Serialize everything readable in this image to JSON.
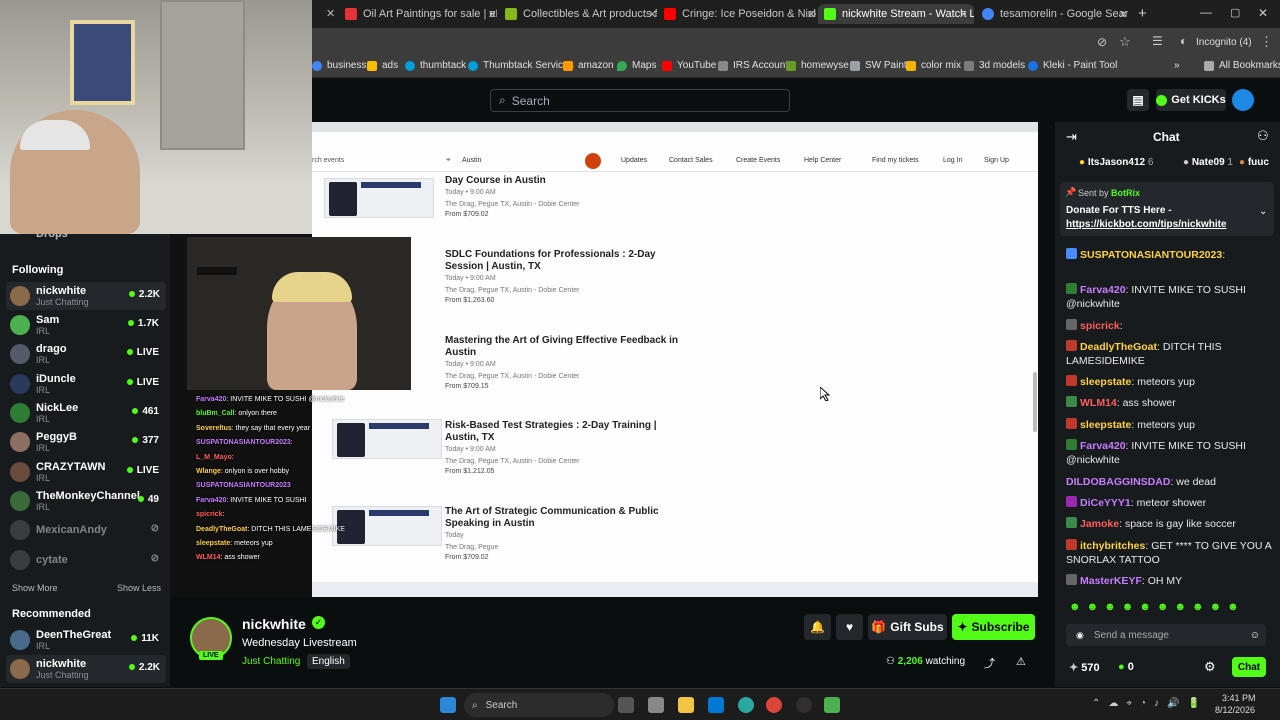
{
  "tabs": [
    {
      "title": "Oil Art Paintings for sale | eBay",
      "color": "#e53238"
    },
    {
      "title": "Collectibles & Art products for",
      "color": "#86b817"
    },
    {
      "title": "Cringe: Ice Poseidon & Nick W",
      "color": "#ff0000"
    },
    {
      "title": "nickwhite Stream - Watch Live",
      "color": "#53fc18"
    },
    {
      "title": "tesamorelin - Google Search",
      "color": "#4285f4"
    }
  ],
  "browser": {
    "incognito": "Incognito (4)",
    "all_bookmarks": "All Bookmarks"
  },
  "bookmarks": [
    {
      "label": "business",
      "color": "#4285f4"
    },
    {
      "label": "ads",
      "color": "#fbbc04"
    },
    {
      "label": "thumbtack",
      "color": "#009fd9"
    },
    {
      "label": "Thumbtack Services",
      "color": "#009fd9"
    },
    {
      "label": "amazon",
      "color": "#ff9900"
    },
    {
      "label": "Maps",
      "color": "#34a853"
    },
    {
      "label": "YouTube",
      "color": "#ff0000"
    },
    {
      "label": "IRS Account",
      "color": "#888888"
    },
    {
      "label": "homewyse",
      "color": "#6a9a2a"
    },
    {
      "label": "SW Paint",
      "color": "#9aa0a6"
    },
    {
      "label": "color mix",
      "color": "#f4b400"
    },
    {
      "label": "3d models",
      "color": "#7b7b7b"
    },
    {
      "label": "Kleki - Paint Tool",
      "color": "#1a73e8"
    }
  ],
  "header": {
    "search_placeholder": "Search",
    "get_kicks": "Get KICKs"
  },
  "sidebar": {
    "drops": "Drops",
    "following_title": "Following",
    "following": [
      {
        "name": "nickwhite",
        "category": "Just Chatting",
        "count": "2.2K",
        "color": "#8a6a4a"
      },
      {
        "name": "Sam",
        "category": "IRL",
        "count": "1.7K",
        "color": "#4caf50"
      },
      {
        "name": "drago",
        "category": "IRL",
        "count": "LIVE",
        "color": "#555a6a"
      },
      {
        "name": "iDuncle",
        "category": "IRL",
        "count": "LIVE",
        "color": "#2a3a5a"
      },
      {
        "name": "NickLee",
        "category": "IRL",
        "count": "461",
        "color": "#2e7d32"
      },
      {
        "name": "PeggyB",
        "category": "IRL",
        "count": "377",
        "color": "#8d6e63"
      },
      {
        "name": "CRAZYTAWN",
        "category": "IRL",
        "count": "LIVE",
        "color": "#6a4a3a"
      },
      {
        "name": "TheMonkeyChannel",
        "category": "IRL",
        "count": "49",
        "color": "#3a6a3a"
      }
    ],
    "offline": [
      "MexicanAndy",
      "cytate"
    ],
    "show_more": "Show More",
    "show_less": "Show Less",
    "recommended_title": "Recommended",
    "recommended": [
      {
        "name": "DeenTheGreat",
        "category": "IRL",
        "count": "11K",
        "color": "#4a6a8a"
      },
      {
        "name": "nickwhite",
        "category": "Just Chatting",
        "count": "2.2K",
        "color": "#8a6a4a"
      }
    ]
  },
  "screen": {
    "search_events": "rch events",
    "location": "Austin",
    "nav": [
      "Updates",
      "Contact Sales",
      "Create Events",
      "Help Center",
      "Find my tickets",
      "Log In",
      "Sign Up"
    ],
    "events": [
      {
        "title": "Day Course in Austin",
        "time": "Today • 9:00 AM",
        "venue": "The Drag, Pegue TX, Austin - Dobie Center",
        "price": "From $709.02"
      },
      {
        "title": "SDLC Foundations for Professionals : 2-Day Session | Austin, TX",
        "time": "Today • 9:00 AM",
        "venue": "The Drag, Pegue TX, Austin - Dobie Center",
        "price": "From $1,263.60"
      },
      {
        "title": "Mastering the Art of Giving Effective Feedback in Austin",
        "time": "Today • 9:00 AM",
        "venue": "The Drag, Pegue TX, Austin - Dobie Center",
        "price": "From $709.15"
      },
      {
        "title": "Risk-Based Test Strategies : 2-Day Training | Austin, TX",
        "time": "Today • 9:00 AM",
        "venue": "The Drag, Pegue TX, Austin - Dobie Center",
        "price": "From $1,212.05"
      },
      {
        "title": "The Art of Strategic Communication & Public Speaking in Austin",
        "time": "Today",
        "venue": "The Drag, Pegue",
        "price": "From $709.02"
      }
    ],
    "overlay_chat": [
      {
        "user": "Farva420",
        "text": ": INVITE MIKE TO SUSHI @nickwhite",
        "color": "#c77dff"
      },
      {
        "user": "bluBm_Call",
        "text": ": onlyon there",
        "color": "#53fc18"
      },
      {
        "user": "Sovereltus",
        "text": ": they say that every year",
        "color": "#ffd23f"
      },
      {
        "user": "SUSPATONASIANTOUR2023",
        "text": ":",
        "color": "#c77dff"
      },
      {
        "user": "L_M_Mayo",
        "text": ":",
        "color": "#ff5e5b"
      },
      {
        "user": "Wlange",
        "text": ": onlyon is over hobby",
        "color": "#ffd23f"
      },
      {
        "user": "SUSPATONASIANTOUR2023",
        "text": "",
        "color": "#c77dff"
      },
      {
        "user": "Farva420",
        "text": ": INVITE MIKE TO SUSHI",
        "color": "#c77dff"
      },
      {
        "user": "spicrick",
        "text": ":",
        "color": "#ff5e5b"
      },
      {
        "user": "DeadlyTheGoat",
        "text": ": DITCH THIS LAMESIDEMIKE",
        "color": "#ffd23f"
      },
      {
        "user": "sleepstate",
        "text": ": meteors yup",
        "color": "#ffd23f"
      },
      {
        "user": "WLM14",
        "text": ": ass shower",
        "color": "#ff5e5b"
      }
    ]
  },
  "chat": {
    "title": "Chat",
    "top_gifters": [
      {
        "name": "ItsJason412",
        "count": "6"
      },
      {
        "name": "Nate09",
        "count": "1"
      },
      {
        "name": "fuuc",
        "count": ""
      }
    ],
    "pinned_sender_label": "Sent by",
    "pinned_sender": "BotRix",
    "pinned_title": "Donate For TTS Here -",
    "pinned_link": "https://kickbot.com/tips/nickwhite",
    "pinned_behind": "SUSPATONASIANTOUR2023:",
    "messages": [
      {
        "user": "SUSPATONASIANTOUR2023",
        "text": ":",
        "color": "#ffd23f"
      },
      {
        "user": "Farva420",
        "text": ": INVITE MIKE TO SUSHI @nickwhite",
        "color": "#c77dff"
      },
      {
        "user": "spicrick",
        "text": ":",
        "color": "#ff5e5b"
      },
      {
        "user": "DeadlyTheGoat",
        "text": ": DITCH THIS LAMESIDEMIKE",
        "color": "#ffd23f"
      },
      {
        "user": "sleepstate",
        "text": ": meteors yup",
        "color": "#ffd23f"
      },
      {
        "user": "WLM14",
        "text": ": ass shower",
        "color": "#ff5e5b"
      },
      {
        "user": "sleepstate",
        "text": ": meteors yup",
        "color": "#ffd23f"
      },
      {
        "user": "Farva420",
        "text": ": INVITE MIKE TO SUSHI @nickwhite",
        "color": "#c77dff"
      },
      {
        "user": "DILDOBAGGINSDAD",
        "text": ": we dead",
        "color": "#c77dff"
      },
      {
        "user": "DiCeYYY1",
        "text": ": meteor shower",
        "color": "#c77dff"
      },
      {
        "user": "Jamoke",
        "text": ": space is gay like soccer",
        "color": "#ff5e5b"
      },
      {
        "user": "itchybritches",
        "text": ": GET **** TO GIVE YOU A SNORLAX TATTOO",
        "color": "#ffd23f"
      },
      {
        "user": "MasterKEYF",
        "text": ": OH MY",
        "color": "#c77dff"
      }
    ],
    "input_placeholder": "Send a message",
    "points": "570",
    "kicks": "0",
    "chat_button": "Chat"
  },
  "channel": {
    "name": "nickwhite",
    "title": "Wednesday Livestream",
    "category": "Just Chatting",
    "language": "English",
    "live_badge": "LIVE",
    "watching": "2,206",
    "watching_label": "watching",
    "gift_subs": "Gift Subs",
    "subscribe": "Subscribe"
  },
  "taskbar": {
    "search": "Search",
    "time": "3:41 PM",
    "date": "8/12/2026"
  },
  "colors": {
    "kick_green": "#53fc18",
    "bg": "#0b0e0f",
    "panel": "#181b1e"
  }
}
